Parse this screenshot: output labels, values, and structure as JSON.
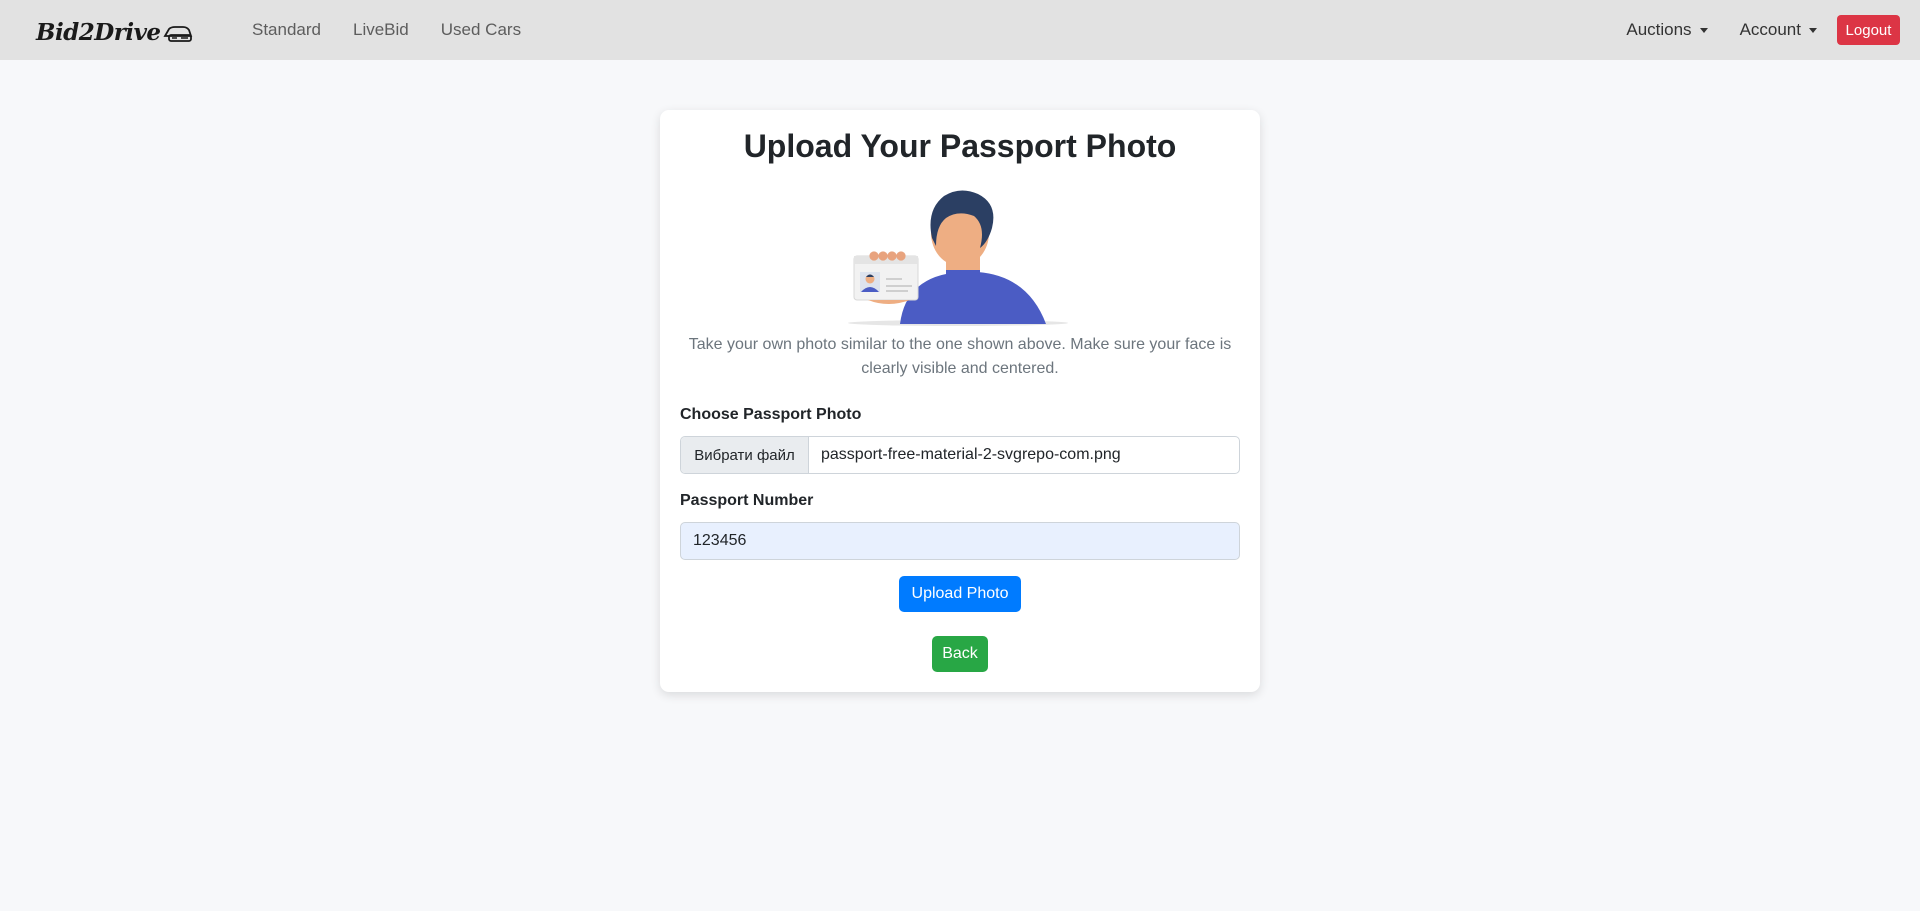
{
  "navbar": {
    "brand": "Bid2Drive",
    "links": [
      "Standard",
      "LiveBid",
      "Used Cars"
    ],
    "auctions_label": "Auctions",
    "account_label": "Account",
    "logout_label": "Logout"
  },
  "card": {
    "title": "Upload Your Passport Photo",
    "hint": "Take your own photo similar to the one shown above. Make sure your face is clearly visible and centered.",
    "file_label": "Choose Passport Photo",
    "file_button": "Вибрати файл",
    "file_name": "passport-free-material-2-svgrepo-com.png",
    "passport_label": "Passport Number",
    "passport_value": "123456",
    "upload_label": "Upload Photo",
    "back_label": "Back"
  },
  "colors": {
    "navbar_bg": "#e2e2e2",
    "logout": "#dc3545",
    "upload": "#007bff",
    "back": "#28a745",
    "autofill_bg": "#e8f0fe"
  },
  "icons": [
    "car-logo-icon",
    "caret-down-icon",
    "passport-illustration"
  ]
}
